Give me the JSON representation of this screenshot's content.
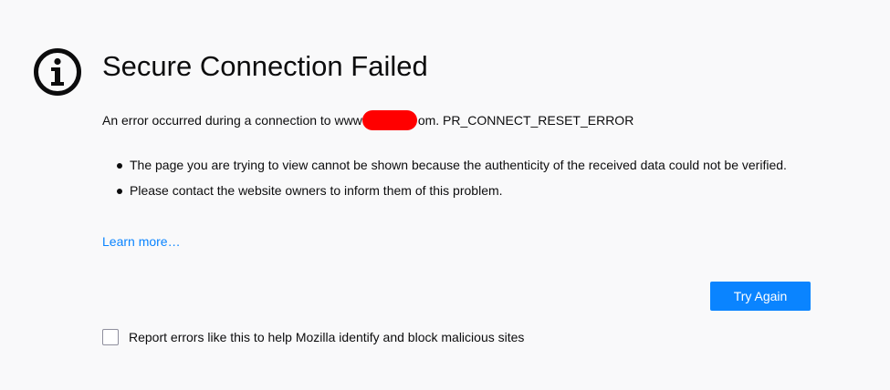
{
  "error_page": {
    "icon": "info-icon",
    "title": "Secure Connection Failed",
    "error_prefix": "An error occurred during a connection to www",
    "error_suffix": "om. PR_CONNECT_RESET_ERROR",
    "bullets": [
      "The page you are trying to view cannot be shown because the authenticity of the received data could not be verified.",
      "Please contact the website owners to inform them of this problem."
    ],
    "learn_more": "Learn more…",
    "try_again_label": "Try Again",
    "report_label": "Report errors like this to help Mozilla identify and block malicious sites",
    "report_checked": false
  },
  "colors": {
    "background": "#f9f9fa",
    "accent": "#0a84ff",
    "redaction": "#ff0000",
    "text": "#0c0c0d"
  }
}
